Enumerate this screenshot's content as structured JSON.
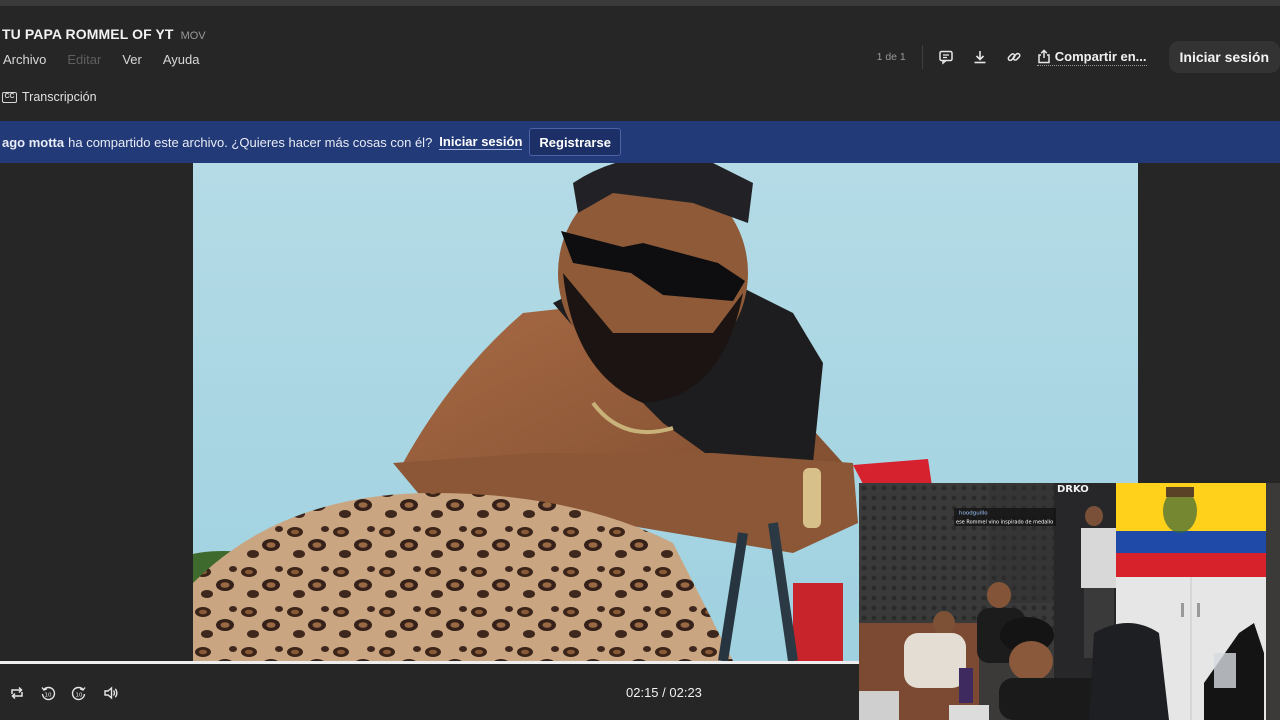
{
  "header": {
    "file_title": "TU PAPA ROMMEL OF YT",
    "file_ext": "MOV",
    "menu": [
      "Archivo",
      "Editar",
      "Ver",
      "Ayuda"
    ],
    "transcript_label": "Transcripción",
    "cc_icon_text": "CC",
    "page_info": "1 de 1",
    "share_label": "Compartir en...",
    "login_label": "Iniciar sesión",
    "icons": [
      "comment-icon",
      "download-icon",
      "link-icon",
      "share-icon"
    ]
  },
  "banner": {
    "user": "ago motta",
    "message": "ha compartido este archivo. ¿Quieres hacer más cosas con él?",
    "login": "Iniciar sesión",
    "register": "Registrarse"
  },
  "player": {
    "time": "02:15 / 02:23",
    "progress": 0.944,
    "icons": [
      "loop-icon",
      "rewind-10-icon",
      "forward-10-icon",
      "volume-icon"
    ]
  },
  "overlay": {
    "logo": "DRKO",
    "chat_user": "hoodguillo",
    "chat_message": "ese Rommel vino inspirado de medallo"
  },
  "colors": {
    "background": "#262626",
    "banner": "#233a78",
    "sky": "#a9d6e4"
  }
}
